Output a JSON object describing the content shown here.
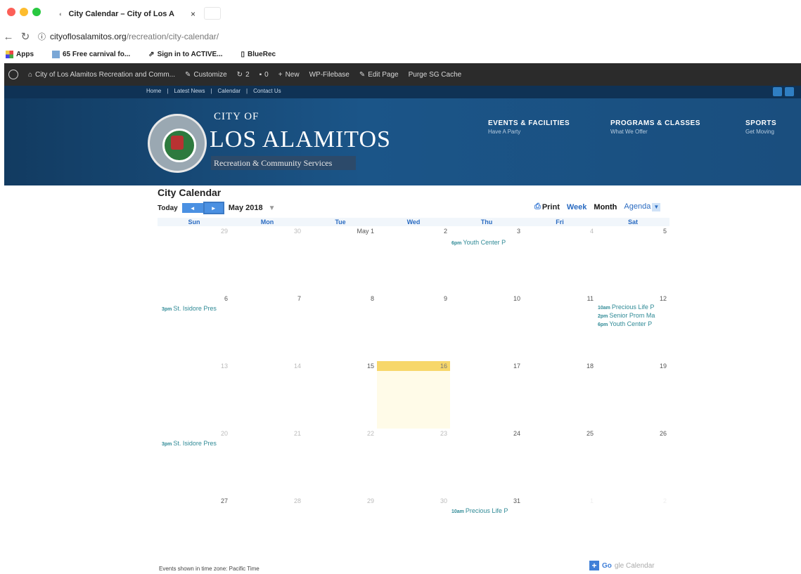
{
  "browser": {
    "tab_title": "City Calendar – City of Los A",
    "tab_close": "×",
    "url_main": "cityoflosalamitos.org",
    "url_path": "/recreation/city-calendar/",
    "bookmarks": [
      "Apps",
      "65 Free carnival fo...",
      "Sign in to ACTIVE...",
      "BlueRec"
    ]
  },
  "wp_admin": {
    "site_name": "City of Los Alamitos Recreation and Comm...",
    "customize": "Customize",
    "updates": "2",
    "comments": "0",
    "new": "New",
    "wp_filebase": "WP-Filebase",
    "edit_page": "Edit Page",
    "purge": "Purge SG Cache"
  },
  "site": {
    "top_links": [
      "Home",
      "Latest News",
      "Calendar",
      "Contact Us"
    ],
    "brand_city": "CITY OF",
    "brand_name": "LOS ALAMITOS",
    "brand_sub": "Recreation & Community Services",
    "nav": [
      {
        "title": "EVENTS & FACILITIES",
        "sub": "Have A Party"
      },
      {
        "title": "PROGRAMS & CLASSES",
        "sub": "What We Offer"
      },
      {
        "title": "SPORTS",
        "sub": "Get Moving"
      }
    ]
  },
  "calendar": {
    "title": "City Calendar",
    "today": "Today",
    "prev": "◄",
    "next": "►",
    "month": "May 2018",
    "month_caret": "▼",
    "views": {
      "print": "Print",
      "week": "Week",
      "month": "Month",
      "agenda": "Agenda",
      "agenda_caret": "▼"
    },
    "dow": [
      "Sun",
      "Mon",
      "Tue",
      "Wed",
      "Thu",
      "Fri",
      "Sat"
    ],
    "weeks": [
      [
        "29",
        "30",
        "May 1",
        "2",
        "3",
        "4",
        "5"
      ],
      [
        "6",
        "7",
        "8",
        "9",
        "10",
        "11",
        "12"
      ],
      [
        "13",
        "14",
        "15",
        "16",
        "17",
        "18",
        "19"
      ],
      [
        "20",
        "21",
        "22",
        "23",
        "24",
        "25",
        "26"
      ],
      [
        "27",
        "28",
        "29",
        "30",
        "31",
        "1",
        "2"
      ]
    ],
    "events": {
      "w0_thu": {
        "time": "6pm",
        "title": "Youth Center P"
      },
      "w1_sun": {
        "time": "3pm",
        "title": "St. Isidore Pres"
      },
      "w1_sat1": {
        "time": "10am",
        "title": "Precious Life P"
      },
      "w1_sat2": {
        "time": "2pm",
        "title": "Senior Prom Ma"
      },
      "w1_sat3": {
        "time": "6pm",
        "title": "Youth Center P"
      },
      "w3_sun": {
        "time": "3pm",
        "title": "St. Isidore Pres"
      },
      "w4_thu": {
        "time": "10am",
        "title": "Precious Life P"
      }
    },
    "timezone_note": "Events shown in time zone: Pacific Time",
    "gcal_g": "Go",
    "gcal_c": "gle Calendar"
  },
  "colors": {
    "accent": "#2a6bc1",
    "event": "#2f8a96",
    "today": "#f7d76a",
    "header": "#1b5588"
  }
}
